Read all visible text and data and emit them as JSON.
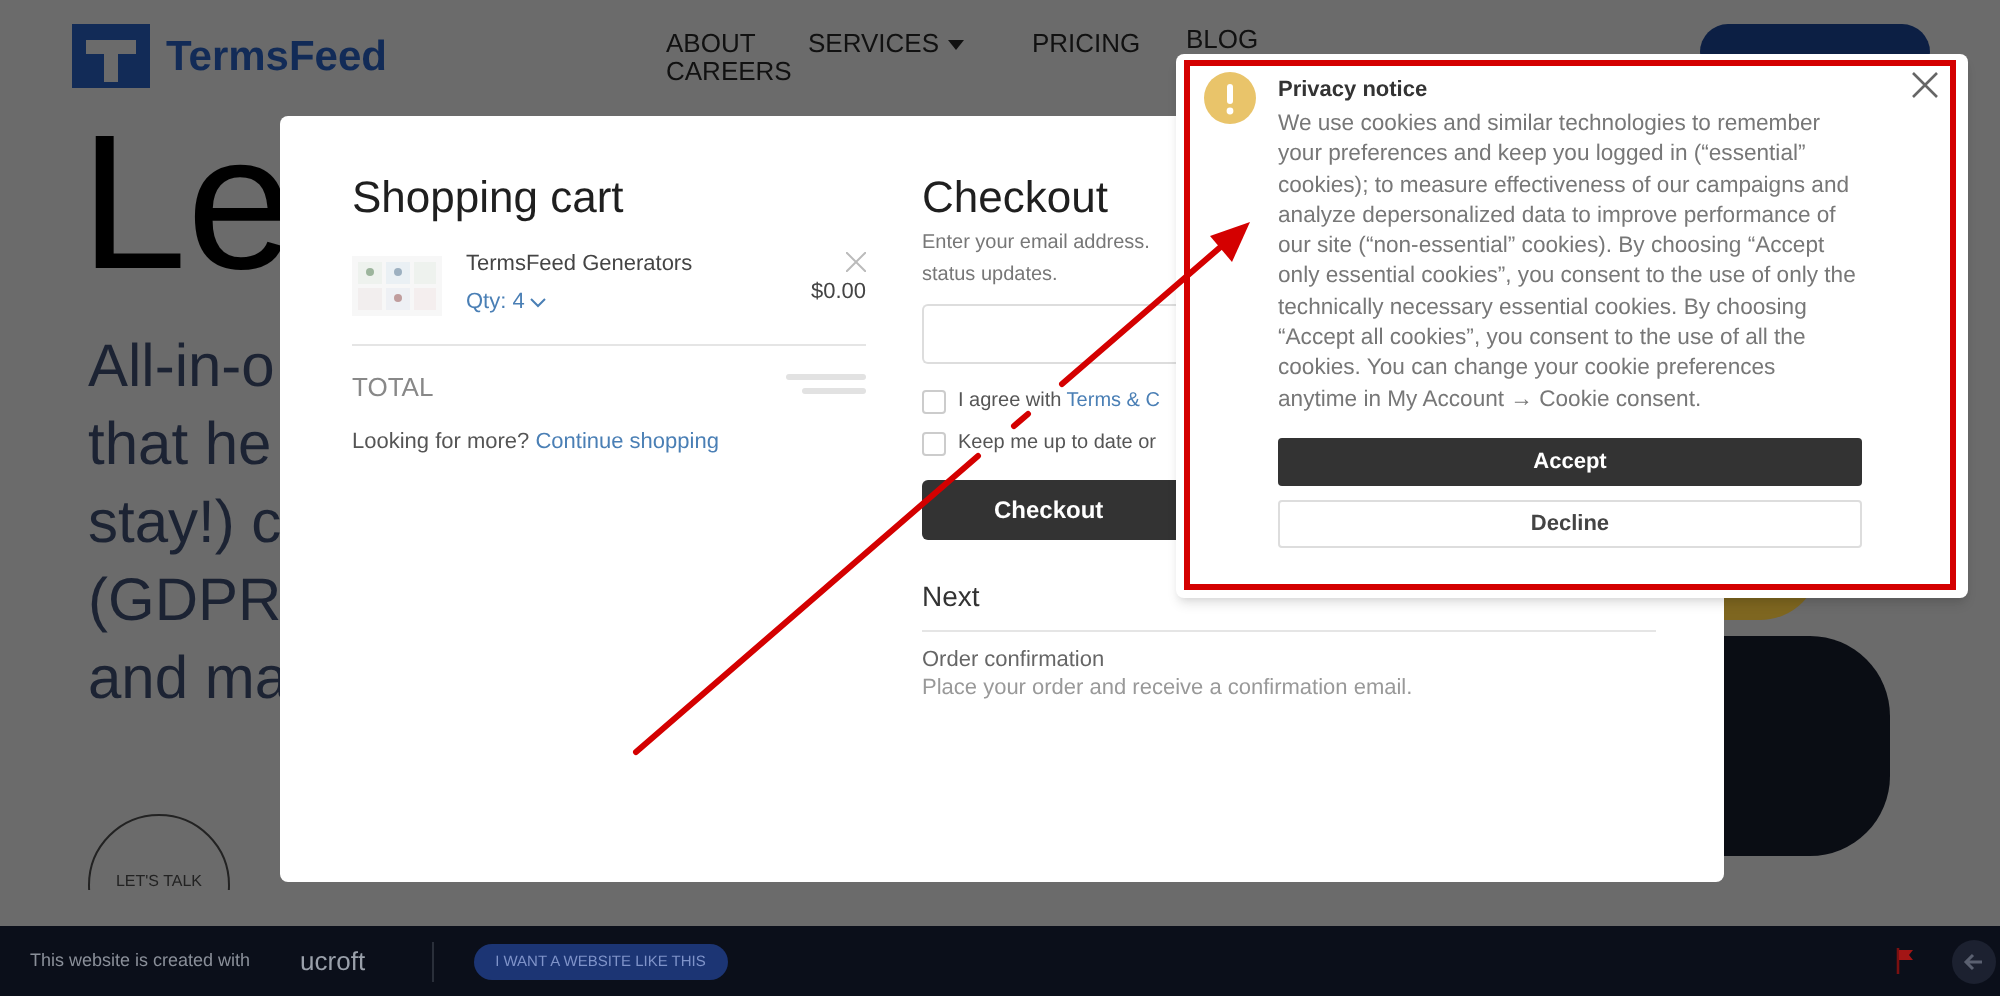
{
  "header": {
    "logo": "TermsFeed",
    "nav": [
      {
        "label": "ABOUT",
        "dropdown": false
      },
      {
        "label": "CAREERS",
        "dropdown": false
      },
      {
        "label": "SERVICES",
        "dropdown": true
      },
      {
        "label": "PRICING",
        "dropdown": false
      },
      {
        "label": "BLOG",
        "dropdown": false
      }
    ]
  },
  "hero": {
    "heading": "Le",
    "lines": [
      "All-in-o",
      "that he",
      "stay!) c",
      "(GDPR",
      "and ma"
    ],
    "lets_talk": "LET'S TALK"
  },
  "cart": {
    "title": "Shopping cart",
    "items": [
      {
        "name": "TermsFeed Generators",
        "qty": "Qty: 4",
        "price": "$0.00"
      }
    ],
    "total_label": "TOTAL",
    "more_text": "Looking for more?",
    "more_link": "Continue shopping"
  },
  "checkout": {
    "title": "Checkout",
    "intro_lines": [
      "Enter your email address.",
      "status updates."
    ],
    "checks": [
      {
        "label": "I agree with",
        "link": "Terms & C",
        "checked": false
      },
      {
        "label": "Keep me up to date or",
        "checked": false
      }
    ],
    "button": "Checkout",
    "next_title": "Next",
    "step_title": "Order confirmation",
    "step_text": "Place your order and receive a confirmation email."
  },
  "privacy": {
    "title": "Privacy notice",
    "body": "We use cookies and similar technologies to remember your preferences and keep you logged in (“essential” cookies); to measure effectiveness of our campaigns and analyze depersonalized data to improve performance of our site (“non-essential” cookies). By choosing “Accept only essential cookies”, you consent to the use of only the technically necessary essential cookies. By choosing “Accept all cookies”, you consent to the use of all the cookies. You can change your cookie preferences anytime in My Account → Cookie consent.",
    "accept": "Accept",
    "decline": "Decline"
  },
  "footer": {
    "text": "This website is created with",
    "brand": "ucroft",
    "button": "I WANT A WEBSITE LIKE THIS"
  }
}
